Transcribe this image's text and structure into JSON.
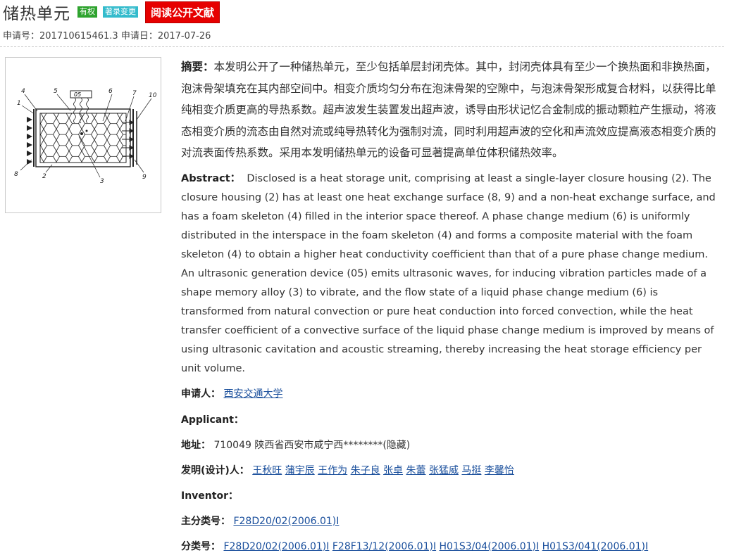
{
  "header": {
    "title": "储热单元",
    "badge_valid": "有权",
    "badge_change": "著录变更",
    "read_button": "阅读公开文献"
  },
  "meta": {
    "app_no_label": "申请号：",
    "app_no": "201710615461.3",
    "app_date_label": "申请日：",
    "app_date": "2017-07-26"
  },
  "abstract_cn": {
    "label": "摘要：",
    "text": "本发明公开了一种储热单元，至少包括单层封闭壳体。其中，封闭壳体具有至少一个换热面和非换热面，泡沫骨架填充在其内部空间中。相变介质均匀分布在泡沫骨架的空隙中，与泡沫骨架形成复合材料，以获得比单纯相变介质更高的导热系数。超声波发生装置发出超声波，诱导由形状记忆合金制成的振动颗粒产生振动，将液态相变介质的流态由自然对流或纯导热转化为强制对流，同时利用超声波的空化和声流效应提高液态相变介质的对流表面传热系数。采用本发明储热单元的设备可显著提高单位体积储热效率。"
  },
  "abstract_en": {
    "label": "Abstract：",
    "text": "Disclosed is a heat storage unit, comprising at least a single-layer closure housing (2). The closure housing (2) has at least one heat exchange surface (8, 9) and a non-heat exchange surface, and has a foam skeleton (4) filled in the interior space thereof. A phase change medium (6) is uniformly distributed in the interspace in the foam skeleton (4) and forms a composite material with the foam skeleton (4) to obtain a higher heat conductivity coefficient than that of a pure phase change medium. An ultrasonic generation device (05) emits ultrasonic waves, for inducing vibration particles made of a shape memory alloy (3) to vibrate, and the flow state of a liquid phase change medium (6) is transformed from natural convection or pure heat conduction into forced convection, while the heat transfer coefficient of a convective surface of the liquid phase change medium is improved by means of using ultrasonic cavitation and acoustic streaming, thereby increasing the heat storage efficiency per unit volume."
  },
  "applicant": {
    "label": "申请人：",
    "value": "西安交通大学"
  },
  "applicant_en": {
    "label": "Applicant："
  },
  "address": {
    "label": "地址：",
    "value": "710049 陕西省西安市咸宁西********(隐藏)"
  },
  "inventors": {
    "label": "发明(设计)人：",
    "names": [
      "王秋旺",
      "蒲宇辰",
      "王作为",
      "朱子良",
      "张卓",
      "朱蕾",
      "张猛威",
      "马挺",
      "李馨怡"
    ]
  },
  "inventor_en": {
    "label": "Inventor："
  },
  "main_class": {
    "label": "主分类号：",
    "value": "F28D20/02(2006.01)I"
  },
  "classes": {
    "label": "分类号：",
    "values": [
      "F28D20/02(2006.01)I",
      "F28F13/12(2006.01)I",
      "H01S3/04(2006.01)I",
      "H01S3/041(2006.01)I"
    ]
  },
  "figure": {
    "label_top": "05",
    "callouts": [
      "4",
      "5",
      "6",
      "7",
      "10",
      "1",
      "8",
      "2",
      "3",
      "9"
    ]
  }
}
